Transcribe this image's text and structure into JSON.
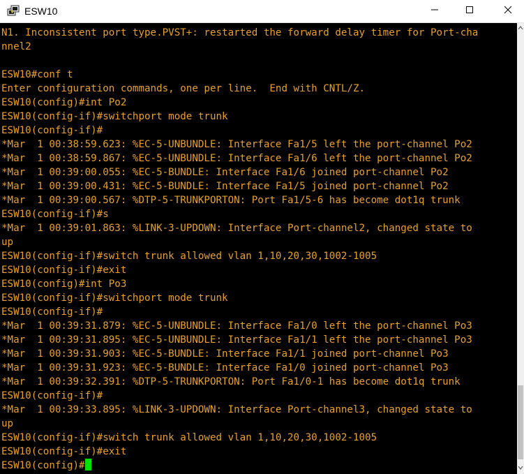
{
  "window": {
    "title": "ESW10",
    "icon": "putty-icon",
    "controls": [
      "minimize-icon",
      "maximize-icon",
      "close-icon"
    ]
  },
  "colors": {
    "terminal_bg": "#000000",
    "terminal_text": "#e8a02a",
    "cursor": "#00e000",
    "titlebar_bg": "#ffffff"
  },
  "terminal": {
    "lines": [
      "N1. Inconsistent port type.PVST+: restarted the forward delay timer for Port-cha",
      "nnel2",
      "",
      "ESW10#conf t",
      "Enter configuration commands, one per line.  End with CNTL/Z.",
      "ESW10(config)#int Po2",
      "ESW10(config-if)#switchport mode trunk",
      "ESW10(config-if)#",
      "*Mar  1 00:38:59.623: %EC-5-UNBUNDLE: Interface Fa1/5 left the port-channel Po2",
      "*Mar  1 00:38:59.867: %EC-5-UNBUNDLE: Interface Fa1/6 left the port-channel Po2",
      "*Mar  1 00:39:00.055: %EC-5-BUNDLE: Interface Fa1/6 joined port-channel Po2",
      "*Mar  1 00:39:00.431: %EC-5-BUNDLE: Interface Fa1/5 joined port-channel Po2",
      "*Mar  1 00:39:00.567: %DTP-5-TRUNKPORTON: Port Fa1/5-6 has become dot1q trunk",
      "ESW10(config-if)#s",
      "*Mar  1 00:39:01.863: %LINK-3-UPDOWN: Interface Port-channel2, changed state to",
      "up",
      "ESW10(config-if)#switch trunk allowed vlan 1,10,20,30,1002-1005",
      "ESW10(config-if)#exit",
      "ESW10(config)#int Po3",
      "ESW10(config-if)#switchport mode trunk",
      "ESW10(config-if)#",
      "*Mar  1 00:39:31.879: %EC-5-UNBUNDLE: Interface Fa1/0 left the port-channel Po3",
      "*Mar  1 00:39:31.895: %EC-5-UNBUNDLE: Interface Fa1/1 left the port-channel Po3",
      "*Mar  1 00:39:31.903: %EC-5-BUNDLE: Interface Fa1/1 joined port-channel Po3",
      "*Mar  1 00:39:31.923: %EC-5-BUNDLE: Interface Fa1/0 joined port-channel Po3",
      "*Mar  1 00:39:32.391: %DTP-5-TRUNKPORTON: Port Fa1/0-1 has become dot1q trunk",
      "ESW10(config-if)#",
      "*Mar  1 00:39:33.895: %LINK-3-UPDOWN: Interface Port-channel3, changed state to",
      "up",
      "ESW10(config-if)#switch trunk allowed vlan 1,10,20,30,1002-1005",
      "ESW10(config-if)#exit"
    ],
    "prompt": "ESW10(config)#"
  }
}
